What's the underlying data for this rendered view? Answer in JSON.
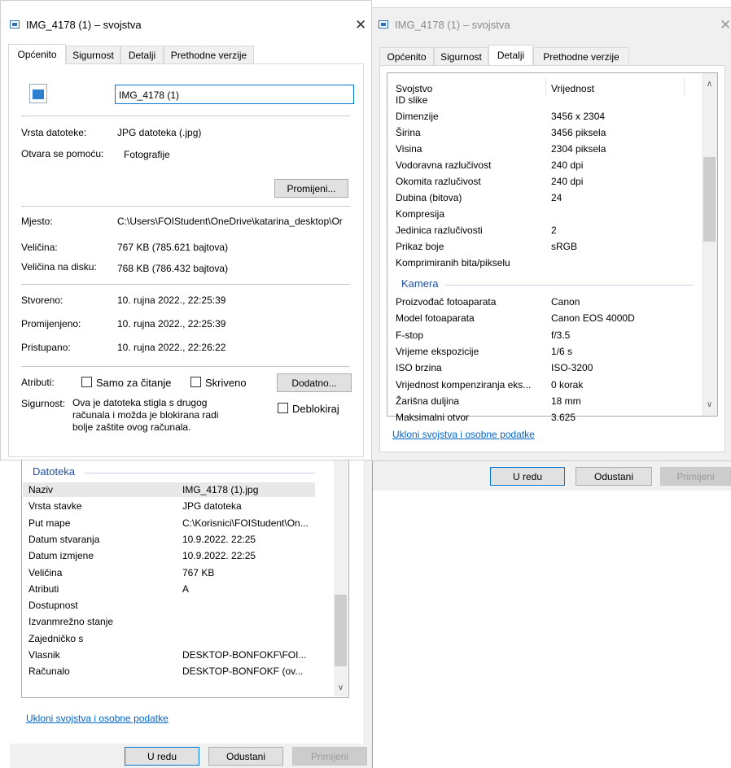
{
  "left_dialog": {
    "title": "IMG_4178 (1) – svojstva",
    "tabs": [
      "Općenito",
      "Sigurnost",
      "Detalji",
      "Prethodne verzije"
    ],
    "file_name_value": "IMG_4178 (1)",
    "type_label": "Vrsta datoteke:",
    "type_value": "JPG datoteka (.jpg)",
    "opens_with_label": "Otvara se pomoću:",
    "opens_with_value": "Fotografije",
    "change_button": "Promijeni...",
    "location_label": "Mjesto:",
    "location_value": "C:\\Users\\FOIStudent\\OneDrive\\katarina_desktop\\Or",
    "size_label": "Veličina:",
    "size_value": "767 KB (785.621 bajtova)",
    "size_on_disk_label": "Veličina na disku:",
    "size_on_disk_value": "768 KB (786.432 bajtova)",
    "created_label": "Stvoreno:",
    "created_value": "10. rujna 2022., 22:25:39",
    "modified_label": "Promijenjeno:",
    "modified_value": "10. rujna 2022., 22:25:39",
    "accessed_label": "Pristupano:",
    "accessed_value": "10. rujna 2022., 22:26:22",
    "attributes_label": "Atributi:",
    "readonly_label": "Samo za čitanje",
    "hidden_label": "Skriveno",
    "advanced_button": "Dodatno...",
    "security_label": "Sigurnost:",
    "security_text_1": "Ova je datoteka stigla s drugog",
    "security_text_2": "računala i možda je blokirana radi",
    "security_text_3": "bolje zaštite ovog računala.",
    "unblock_label": "Deblokiraj"
  },
  "lower_left": {
    "group_title": "Datoteka",
    "rows": [
      {
        "name": "Naziv",
        "value": "IMG_4178 (1).jpg"
      },
      {
        "name": "Vrsta stavke",
        "value": "JPG datoteka"
      },
      {
        "name": "Put mape",
        "value": "C:\\Korisnici\\FOIStudent\\On..."
      },
      {
        "name": "Datum stvaranja",
        "value": "10.9.2022. 22:25"
      },
      {
        "name": "Datum izmjene",
        "value": "10.9.2022. 22:25"
      },
      {
        "name": "Veličina",
        "value": "767 KB"
      },
      {
        "name": "Atributi",
        "value": "A"
      },
      {
        "name": "Dostupnost",
        "value": ""
      },
      {
        "name": "Izvanmrežno stanje",
        "value": ""
      },
      {
        "name": "Zajedničko s",
        "value": ""
      },
      {
        "name": "Vlasnik",
        "value": "DESKTOP-BONFOKF\\FOI..."
      },
      {
        "name": "Računalo",
        "value": "DESKTOP-BONFOKF (ov..."
      }
    ],
    "remove_link": "Ukloni svojstva i osobne podatke",
    "ok_button": "U redu",
    "cancel_button": "Odustani",
    "apply_button": "Primijeni"
  },
  "right_dialog": {
    "title": "IMG_4178 (1) – svojstva",
    "tabs": [
      "Općenito",
      "Sigurnost",
      "Detalji",
      "Prethodne verzije"
    ],
    "header_property": "Svojstvo",
    "header_value": "Vrijednost",
    "rows_top": [
      {
        "name": "ID slike",
        "value": ""
      },
      {
        "name": "Dimenzije",
        "value": "3456 x 2304"
      },
      {
        "name": "Širina",
        "value": "3456 piksela"
      },
      {
        "name": "Visina",
        "value": "2304 piksela"
      },
      {
        "name": "Vodoravna razlučivost",
        "value": "240 dpi"
      },
      {
        "name": "Okomita razlučivost",
        "value": "240 dpi"
      },
      {
        "name": "Dubina (bitova)",
        "value": "24"
      },
      {
        "name": "Kompresija",
        "value": ""
      },
      {
        "name": "Jedinica razlučivosti",
        "value": "2"
      },
      {
        "name": "Prikaz boje",
        "value": "sRGB"
      },
      {
        "name": "Komprimiranih bita/pikselu",
        "value": ""
      }
    ],
    "group_camera": "Kamera",
    "rows_camera": [
      {
        "name": "Proizvođač fotoaparata",
        "value": "Canon"
      },
      {
        "name": "Model fotoaparata",
        "value": "Canon EOS 4000D"
      },
      {
        "name": "F-stop",
        "value": "f/3.5"
      },
      {
        "name": "Vrijeme ekspozicije",
        "value": "1/6 s"
      },
      {
        "name": "ISO brzina",
        "value": "ISO-3200"
      },
      {
        "name": "Vrijednost kompenziranja eks...",
        "value": "0 korak"
      },
      {
        "name": "Žarišna duljina",
        "value": "18 mm"
      },
      {
        "name": "Maksimalni otvor",
        "value": "3.625"
      }
    ],
    "remove_link": "Ukloni svojstva i osobne podatke",
    "ok_button": "U redu",
    "cancel_button": "Odustani",
    "apply_button": "Primijeni"
  }
}
